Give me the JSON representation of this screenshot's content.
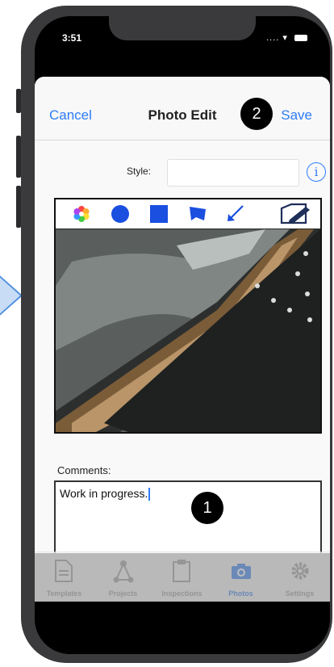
{
  "status_bar": {
    "time": "3:51",
    "signal": "...."
  },
  "nav": {
    "cancel_label": "Cancel",
    "title": "Photo Edit",
    "save_label": "Save"
  },
  "badges": {
    "save_step": "2",
    "comment_step": "1"
  },
  "style_field": {
    "label": "Style:",
    "value": ""
  },
  "info_icon": "info-circle-icon",
  "toolbar_tools": [
    "color-wheel-icon",
    "circle-tool-icon",
    "square-tool-icon",
    "freeform-shape-icon",
    "arrow-tool-icon",
    "edit-icon"
  ],
  "comments": {
    "label": "Comments:",
    "value": "Work in progress."
  },
  "tabs": [
    {
      "label": "Templates",
      "icon": "document-icon",
      "active": false
    },
    {
      "label": "Projects",
      "icon": "projects-icon",
      "active": false
    },
    {
      "label": "Inspections",
      "icon": "clipboard-icon",
      "active": false
    },
    {
      "label": "Photos",
      "icon": "camera-icon",
      "active": true
    },
    {
      "label": "Settings",
      "icon": "gear-icon",
      "active": false
    }
  ],
  "colors": {
    "accent": "#2f7cf6",
    "tool_blue": "#1a4fe0",
    "frame": "#3a3a3c",
    "badge": "#000000"
  }
}
